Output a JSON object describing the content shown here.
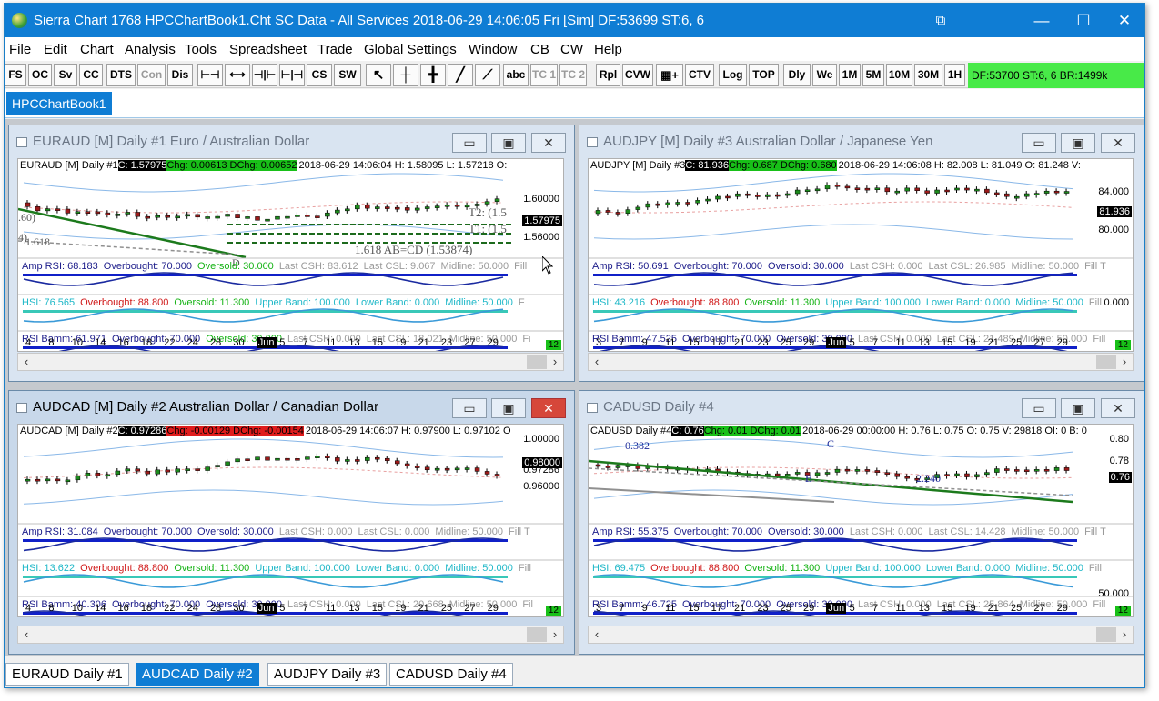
{
  "window": {
    "title": "Sierra Chart 1768 HPCChartBook1.Cht  SC Data - All Services 2018-06-29  14:06:05 Fri [Sim]  DF:53699  ST:6, 6",
    "minimize": "—",
    "maximize": "☐",
    "close": "✕",
    "pin": "⧉"
  },
  "menu": [
    "File",
    "Edit",
    "Chart",
    "Analysis",
    "Tools",
    "Spreadsheet",
    "Trade",
    "Global Settings",
    "Window",
    "CB",
    "CW",
    "Help"
  ],
  "toolbar": {
    "buttons": [
      "FS",
      "OC",
      "Sv",
      "CC",
      "DTS",
      "Con",
      "Dis",
      "CS",
      "SW",
      "abc",
      "TC 1",
      "TC 2",
      "Rpl",
      "CVW",
      "CTV",
      "Log",
      "TOP",
      "Dly",
      "We",
      "1M",
      "5M",
      "10M",
      "30M",
      "1H"
    ],
    "status": "DF:53700  ST:6, 6  BR:1499k"
  },
  "chartbook_tab": "HPCChartBook1",
  "charts": [
    {
      "title": "EURAUD [M]  Daily  #1  Euro / Australian Dollar",
      "info": {
        "sym": "EURAUD [M]  Daily  #1",
        "close": "C: 1.57975",
        "chg": "Chg: 0.00613 DChg: 0.00652",
        "rest": "2018-06-29 14:06:04 H: 1.58095 L: 1.57218 O:"
      },
      "price_labels": [
        "1.60000",
        "1.57975",
        "1.56000"
      ],
      "annotations": [
        "T2: (1.5",
        "T1: (1.5",
        "1.618 AB=CD (1.53874)",
        ".60)",
        "4)",
        "1.618",
        "D"
      ],
      "studies": [
        [
          [
            "Amp RSI: 68.183",
            "sval"
          ],
          [
            "Overbought: 70.000",
            "sval"
          ],
          [
            "Oversold: 30.000",
            "grn"
          ],
          [
            "Last CSH: 83.612",
            "gry"
          ],
          [
            "Last CSL: 9.067",
            "gry"
          ],
          [
            "Midline: 50.000",
            "gry"
          ],
          [
            "Fill",
            "gry"
          ]
        ],
        [
          [
            "HSI: 76.565",
            "cyan"
          ],
          [
            "Overbought: 88.800",
            "red"
          ],
          [
            "Oversold: 11.300",
            "grn"
          ],
          [
            "Upper Band: 100.000",
            "cyan"
          ],
          [
            "Lower Band: 0.000",
            "cyan"
          ],
          [
            "Midline: 50.000",
            "cyan"
          ],
          [
            "F",
            "gry"
          ]
        ],
        [
          [
            "RSI Bamm: 61.971",
            "sval"
          ],
          [
            "Overbought: 70.000",
            "sval"
          ],
          [
            "Oversold: 30.000",
            "grn"
          ],
          [
            "Last CSH: 0.000",
            "gry"
          ],
          [
            "Last CSL: 18.021",
            "gry"
          ],
          [
            "Midline: 50.000",
            "gry"
          ],
          [
            "Fi",
            "gry"
          ]
        ]
      ],
      "xaxis": [
        "4",
        "8",
        "10",
        "14",
        "16",
        "18",
        "22",
        "24",
        "28",
        "30",
        "Jun",
        "5",
        "7",
        "11",
        "13",
        "15",
        "19",
        "21",
        "23",
        "27",
        "29"
      ],
      "count": "12"
    },
    {
      "title": "AUDJPY [M]  Daily  #3  Australian Dollar / Japanese Yen",
      "info": {
        "sym": "AUDJPY [M]  Daily  #3",
        "close": "C: 81.936",
        "chg": "Chg: 0.687 DChg: 0.680",
        "rest": "2018-06-29 14:06:08 H: 82.008 L: 81.049 O: 81.248 V:"
      },
      "price_labels": [
        "84.000",
        "81.936",
        "80.000",
        "0.000"
      ],
      "annotations": [],
      "studies": [
        [
          [
            "Amp RSI: 50.691",
            "sval"
          ],
          [
            "Overbought: 70.000",
            "sval"
          ],
          [
            "Oversold: 30.000",
            "sval"
          ],
          [
            "Last CSH: 0.000",
            "gry"
          ],
          [
            "Last CSL: 26.985",
            "gry"
          ],
          [
            "Midline: 50.000",
            "gry"
          ],
          [
            "Fill T",
            "gry"
          ]
        ],
        [
          [
            "HSI: 43.216",
            "cyan"
          ],
          [
            "Overbought: 88.800",
            "red"
          ],
          [
            "Oversold: 11.300",
            "grn"
          ],
          [
            "Upper Band: 100.000",
            "cyan"
          ],
          [
            "Lower Band: 0.000",
            "cyan"
          ],
          [
            "Midline: 50.000",
            "cyan"
          ],
          [
            "Fill",
            "gry"
          ]
        ],
        [
          [
            "RSI Bamm: 47.525",
            "sval"
          ],
          [
            "Overbought: 70.000",
            "sval"
          ],
          [
            "Oversold: 30.000",
            "sval"
          ],
          [
            "Last CSH: 0.000",
            "gry"
          ],
          [
            "Last CSL: 21.489",
            "gry"
          ],
          [
            "Midline: 50.000",
            "gry"
          ],
          [
            "Fill",
            "gry"
          ]
        ]
      ],
      "xaxis": [
        "3",
        "7",
        "9",
        "11",
        "15",
        "17",
        "21",
        "23",
        "25",
        "29",
        "Jun",
        "5",
        "7",
        "11",
        "13",
        "15",
        "19",
        "21",
        "25",
        "27",
        "29"
      ],
      "count": "12"
    },
    {
      "title": "AUDCAD [M]  Daily  #2  Australian Dollar / Canadian Dollar",
      "info": {
        "sym": "AUDCAD [M]  Daily  #2",
        "close": "C: 0.97286",
        "chg": "Chg: -0.00129 DChg: -0.00154",
        "rest": "2018-06-29 14:06:07 H: 0.97900 L: 0.97102 O"
      },
      "price_labels": [
        "1.00000",
        "0.98000",
        "0.97286",
        "0.96000"
      ],
      "annotations": [],
      "studies": [
        [
          [
            "Amp RSI: 31.084",
            "sval"
          ],
          [
            "Overbought: 70.000",
            "sval"
          ],
          [
            "Oversold: 30.000",
            "sval"
          ],
          [
            "Last CSH: 0.000",
            "gry"
          ],
          [
            "Last CSL: 0.000",
            "gry"
          ],
          [
            "Midline: 50.000",
            "gry"
          ],
          [
            "Fill T",
            "gry"
          ]
        ],
        [
          [
            "HSI: 13.622",
            "cyan"
          ],
          [
            "Overbought: 88.800",
            "red"
          ],
          [
            "Oversold: 11.300",
            "grn"
          ],
          [
            "Upper Band: 100.000",
            "cyan"
          ],
          [
            "Lower Band: 0.000",
            "cyan"
          ],
          [
            "Midline: 50.000",
            "cyan"
          ],
          [
            "Fill",
            "gry"
          ]
        ],
        [
          [
            "RSI Bamm: 40.306",
            "sval"
          ],
          [
            "Overbought: 70.000",
            "sval"
          ],
          [
            "Oversold: 30.000",
            "sval"
          ],
          [
            "Last CSH: 0.000",
            "gry"
          ],
          [
            "Last CSL: 20.668",
            "gry"
          ],
          [
            "Midline: 50.000",
            "gry"
          ],
          [
            "Fil",
            "gry"
          ]
        ]
      ],
      "xaxis": [
        "4",
        "8",
        "10",
        "14",
        "16",
        "18",
        "22",
        "24",
        "28",
        "30",
        "Jun",
        "5",
        "7",
        "11",
        "13",
        "15",
        "19",
        "21",
        "25",
        "27",
        "29"
      ],
      "count": "12"
    },
    {
      "title": "CADUSD  Daily  #4",
      "info": {
        "sym": "CADUSD  Daily  #4",
        "close": "C: 0.76",
        "chg": "Chg: 0.01 DChg: 0.01",
        "rest": "2018-06-29 00:00:00 H: 0.76 L: 0.75 O: 0.75 V: 29818 OI: 0 B: 0"
      },
      "price_labels": [
        "0.80",
        "0.78",
        "0.76",
        "50.000"
      ],
      "annotations": [
        "0.382",
        "C",
        "B",
        "2.240"
      ],
      "studies": [
        [
          [
            "Amp RSI: 55.375",
            "sval"
          ],
          [
            "Overbought: 70.000",
            "sval"
          ],
          [
            "Oversold: 30.000",
            "sval"
          ],
          [
            "Last CSH: 0.000",
            "gry"
          ],
          [
            "Last CSL: 14.428",
            "gry"
          ],
          [
            "Midline: 50.000",
            "gry"
          ],
          [
            "Fill T",
            "gry"
          ]
        ],
        [
          [
            "HSI: 69.475",
            "cyan"
          ],
          [
            "Overbought: 88.800",
            "red"
          ],
          [
            "Oversold: 11.300",
            "grn"
          ],
          [
            "Upper Band: 100.000",
            "cyan"
          ],
          [
            "Lower Band: 0.000",
            "cyan"
          ],
          [
            "Midline: 50.000",
            "cyan"
          ],
          [
            "Fill",
            "gry"
          ]
        ],
        [
          [
            "RSI Bamm: 46.725",
            "sval"
          ],
          [
            "Overbought: 70.000",
            "sval"
          ],
          [
            "Oversold: 30.000",
            "sval"
          ],
          [
            "Last CSH: 0.000",
            "gry"
          ],
          [
            "Last CSL: 25.864",
            "gry"
          ],
          [
            "Midline: 50.000",
            "gry"
          ],
          [
            "Fill",
            "gry"
          ]
        ]
      ],
      "xaxis": [
        "3",
        "7",
        "9",
        "11",
        "15",
        "17",
        "21",
        "23",
        "25",
        "29",
        "Jun",
        "5",
        "7",
        "11",
        "13",
        "15",
        "19",
        "21",
        "25",
        "27",
        "29"
      ],
      "count": "12"
    }
  ],
  "bottom_tabs": [
    "EURAUD   Daily  #1",
    "AUDCAD   Daily  #2",
    "AUDJPY   Daily  #3",
    "CADUSD  Daily  #4"
  ],
  "colors": {
    "titlebar": "#0f7dd4",
    "status_green": "#48ea48",
    "up_candle": "#1c8a1c",
    "down_candle": "#9a1a1a",
    "band": "#8ab8e8",
    "trend": "#1c7a1c"
  }
}
